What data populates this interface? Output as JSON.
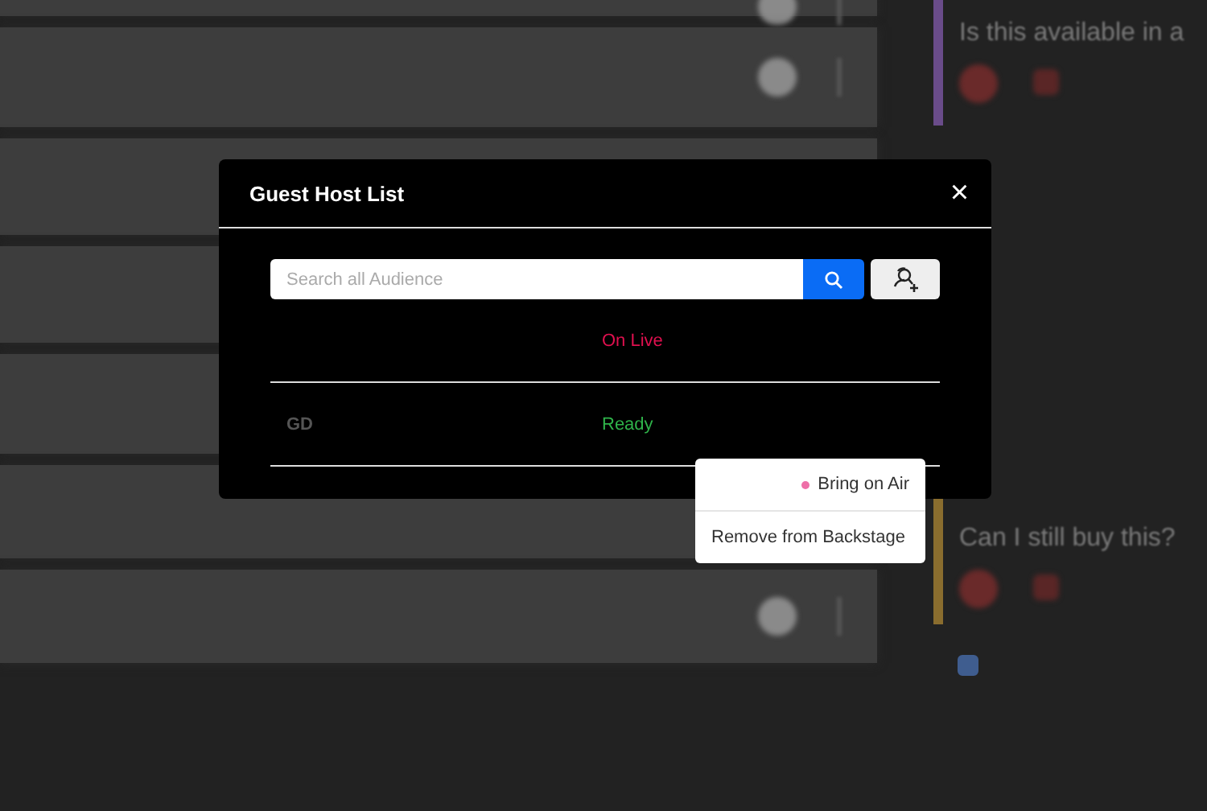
{
  "background": {
    "questions": [
      {
        "text": "Is this available in a",
        "color": "#6a4c8a"
      },
      {
        "text": "Can I still buy this?",
        "color": "#8a6d2e"
      }
    ],
    "filter": {
      "checked": true
    }
  },
  "modal": {
    "title": "Guest Host List",
    "close": "×",
    "search": {
      "placeholder": "Search all Audience"
    },
    "rows": [
      {
        "initials": "",
        "status": "On Live",
        "kind": "live"
      },
      {
        "initials": "GD",
        "status": "Ready",
        "kind": "ready"
      }
    ]
  },
  "menu": {
    "items": [
      {
        "label": "Bring on Air",
        "kind": "indicator"
      },
      {
        "label": "Remove from Backstage",
        "kind": "plain"
      }
    ]
  }
}
